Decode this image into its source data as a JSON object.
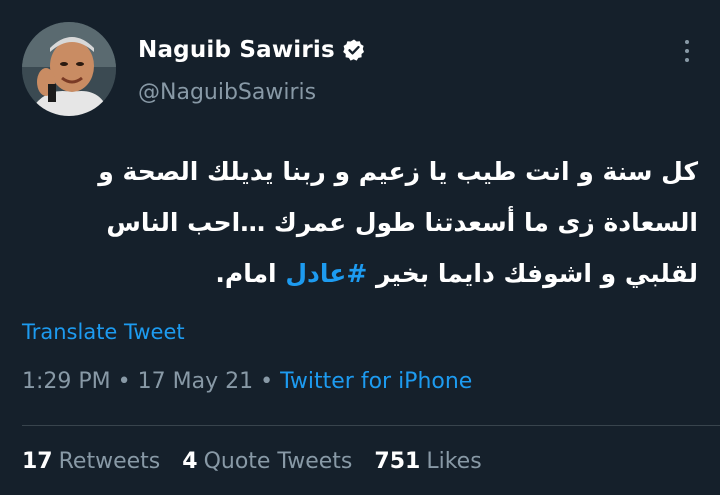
{
  "tweet": {
    "display_name": "Naguib Sawiris",
    "handle": "@NaguibSawiris",
    "text_line1": "كل سنة و انت طيب يا زعيم و ربنا يديلك الصحة و",
    "text_line2": "السعادة زى ما أسعدتنا طول عمرك …احب الناس",
    "text_line3_a": "لقلبي و اشوفك دايما بخير ",
    "hashtag": "#عادل",
    "text_line3_b": " امام.",
    "translate_label": "Translate Tweet",
    "time": "1:29 PM",
    "date": "17 May 21",
    "separator": "•",
    "source": "Twitter for iPhone",
    "retweets_count": "17",
    "retweets_label": "Retweets",
    "quotes_count": "4",
    "quotes_label": "Quote Tweets",
    "likes_count": "751",
    "likes_label": "Likes"
  },
  "icons": {
    "verified": "verified-badge-icon",
    "more": "more-vertical-icon"
  },
  "colors": {
    "background": "#15202b",
    "accent": "#1d9bf0",
    "muted": "#8899a6",
    "text": "#ffffff"
  }
}
